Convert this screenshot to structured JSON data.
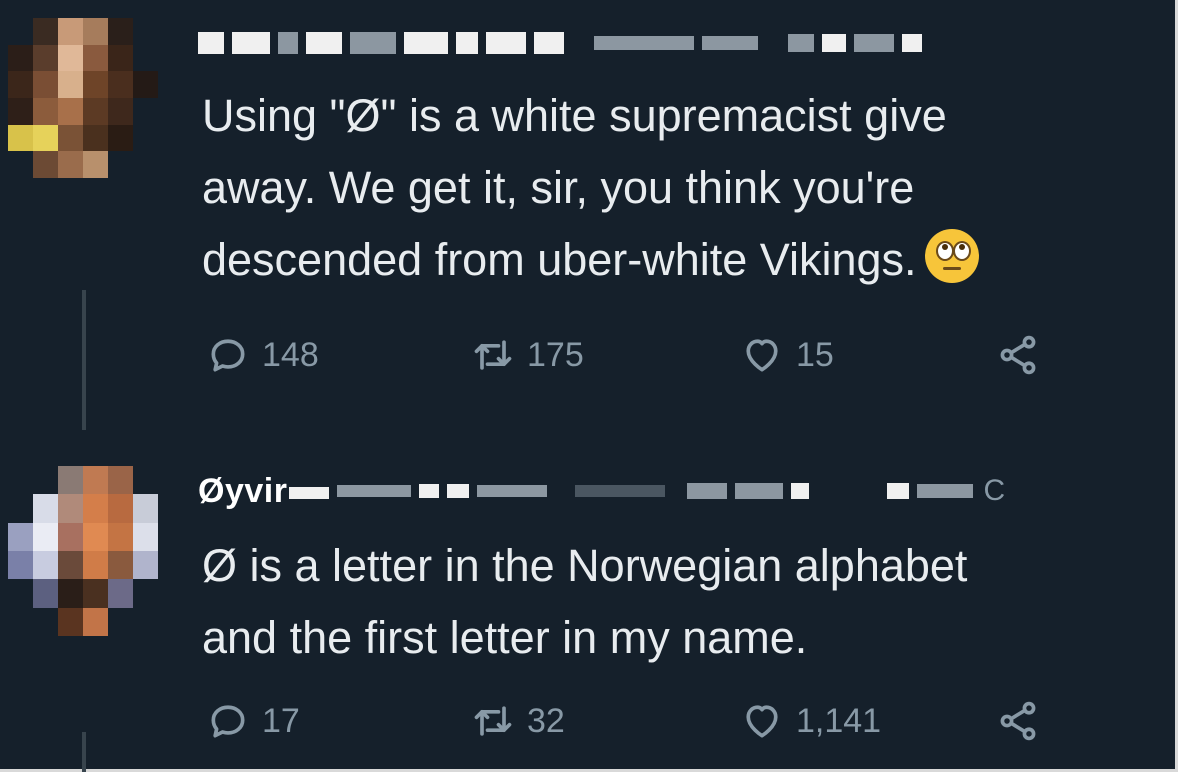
{
  "tweets": [
    {
      "name_visible": "",
      "body": "Using \"Ø\" is a white supremacist give\naway.  We get it, sir, you think you're\ndescended from uber-white Vikings.",
      "emoji": "face-with-rolling-eyes",
      "replies": "148",
      "retweets": "175",
      "likes": "15"
    },
    {
      "name_visible": "Øyvir",
      "header_trailing": "C",
      "body": "Ø is a letter in the Norwegian alphabet\nand the first letter in my name.",
      "replies": "17",
      "retweets": "32",
      "likes": "1,141"
    }
  ],
  "icons": {
    "reply": "reply-icon",
    "retweet": "retweet-icon",
    "like": "heart-icon",
    "share": "share-icon"
  },
  "colors": {
    "background": "#15202b",
    "text": "#e8ecef",
    "muted": "#8899a6",
    "thread_line": "#38444d"
  }
}
